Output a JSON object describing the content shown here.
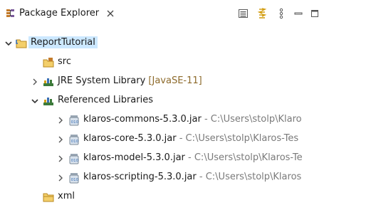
{
  "view": {
    "title": "Package Explorer",
    "icons": {
      "view": "package-explorer-icon",
      "close": "close-icon",
      "collapse_all": "collapse-all-icon",
      "link_with_editor": "link-with-editor-icon",
      "menu": "view-menu-icon",
      "minimize": "minimize-icon",
      "maximize": "maximize-icon"
    }
  },
  "tree": {
    "project": {
      "label": "ReportTutorial",
      "expanded": true,
      "selected": true
    },
    "src": {
      "label": "src"
    },
    "jre": {
      "label": "JRE System Library",
      "decoration": "[JavaSE-11]",
      "expanded": false
    },
    "reflibs": {
      "label": "Referenced Libraries",
      "expanded": true
    },
    "jars": [
      {
        "name": "klaros-commons-5.3.0.jar",
        "sep": " - ",
        "path": "C:\\Users\\stolp\\Klaro"
      },
      {
        "name": "klaros-core-5.3.0.jar",
        "sep": " - ",
        "path": "C:\\Users\\stolp\\Klaros-Tes"
      },
      {
        "name": "klaros-model-5.3.0.jar",
        "sep": " - ",
        "path": "C:\\Users\\stolp\\Klaros-Te"
      },
      {
        "name": "klaros-scripting-5.3.0.jar",
        "sep": " - ",
        "path": "C:\\Users\\stolp\\Klaros"
      }
    ],
    "xml": {
      "label": "xml"
    }
  },
  "colors": {
    "selection": "#cce8ff",
    "decoration": "#8d6a2b",
    "path": "#7a7a7a",
    "folder": "#e8b84a",
    "library": "#3c7a3a"
  }
}
